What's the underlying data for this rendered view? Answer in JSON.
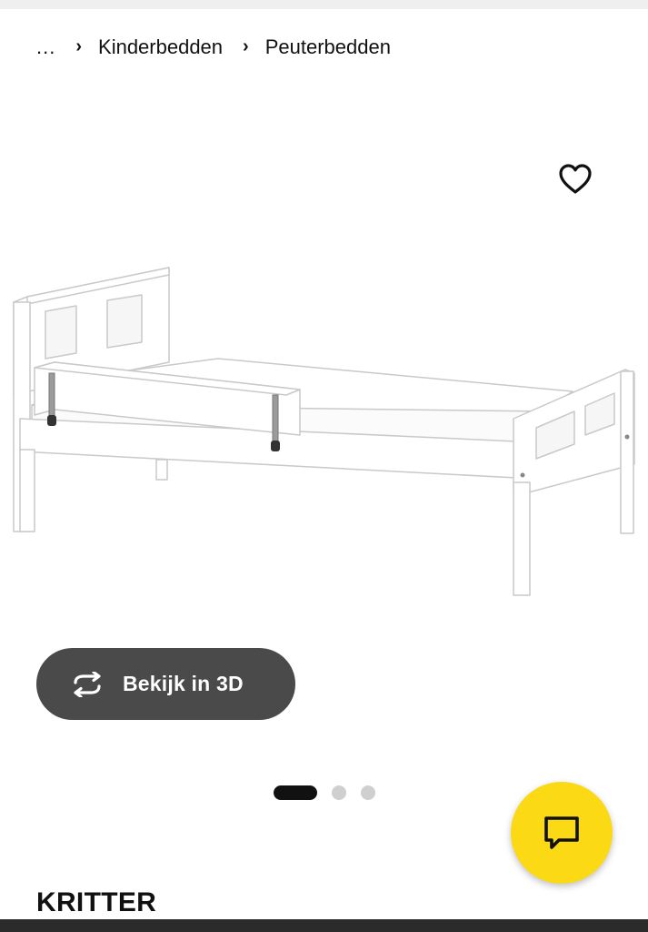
{
  "breadcrumb": {
    "ellipsis": "...",
    "separator": "›",
    "items": [
      {
        "label": "Kinderbedden"
      },
      {
        "label": "Peuterbedden"
      }
    ]
  },
  "favorite": {
    "icon": "heart-outline-icon"
  },
  "product_image": {
    "subject": "white toddler bed with side guard rail"
  },
  "view_3d": {
    "label": "Bekijk in 3D",
    "icon": "rotate-3d-icon"
  },
  "carousel": {
    "total": 3,
    "active_index": 0
  },
  "chat": {
    "icon": "chat-bubble-icon",
    "color": "#fbd914"
  },
  "product": {
    "name": "KRITTER"
  },
  "colors": {
    "button_bg": "#4a4a4a",
    "accent_yellow": "#fbd914",
    "dot_active": "#111111",
    "dot_inactive": "#cfcfcf"
  }
}
